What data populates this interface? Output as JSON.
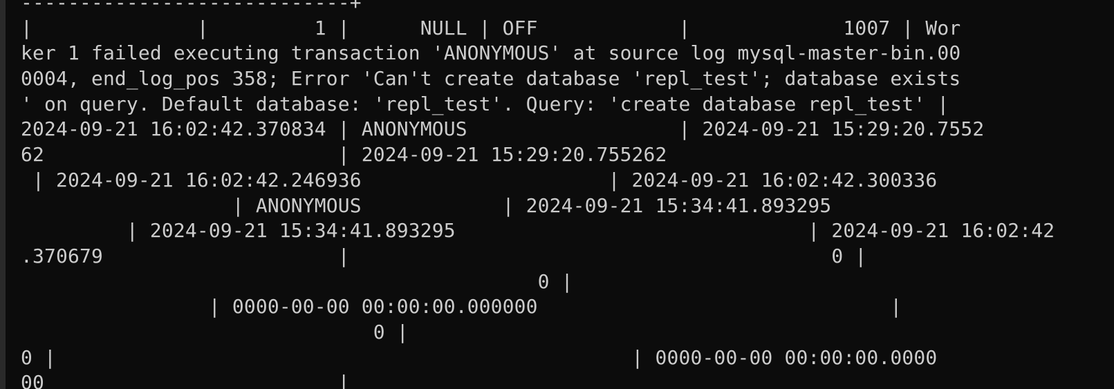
{
  "terminal": {
    "lines": [
      "----------------------------+",
      "|              |         1 |      NULL | OFF            |             1007 | Wor",
      "ker 1 failed executing transaction 'ANONYMOUS' at source log mysql-master-bin.00",
      "0004, end_log_pos 358; Error 'Can't create database 'repl_test'; database exists",
      "' on query. Default database: 'repl_test'. Query: 'create database repl_test' |",
      "2024-09-21 16:02:42.370834 | ANONYMOUS                  | 2024-09-21 15:29:20.7552",
      "62                         | 2024-09-21 15:29:20.755262",
      " | 2024-09-21 16:02:42.246936                     | 2024-09-21 16:02:42.300336",
      "                  | ANONYMOUS            | 2024-09-21 15:34:41.893295",
      "         | 2024-09-21 15:34:41.893295                              | 2024-09-21 16:02:42",
      ".370679                    |                                         0 |",
      "                                            0 |",
      "                | 0000-00-00 00:00:00.000000                              |",
      "                              0 |",
      "0 |                                                 | 0000-00-00 00:00:00.0000",
      "00                         |"
    ]
  }
}
